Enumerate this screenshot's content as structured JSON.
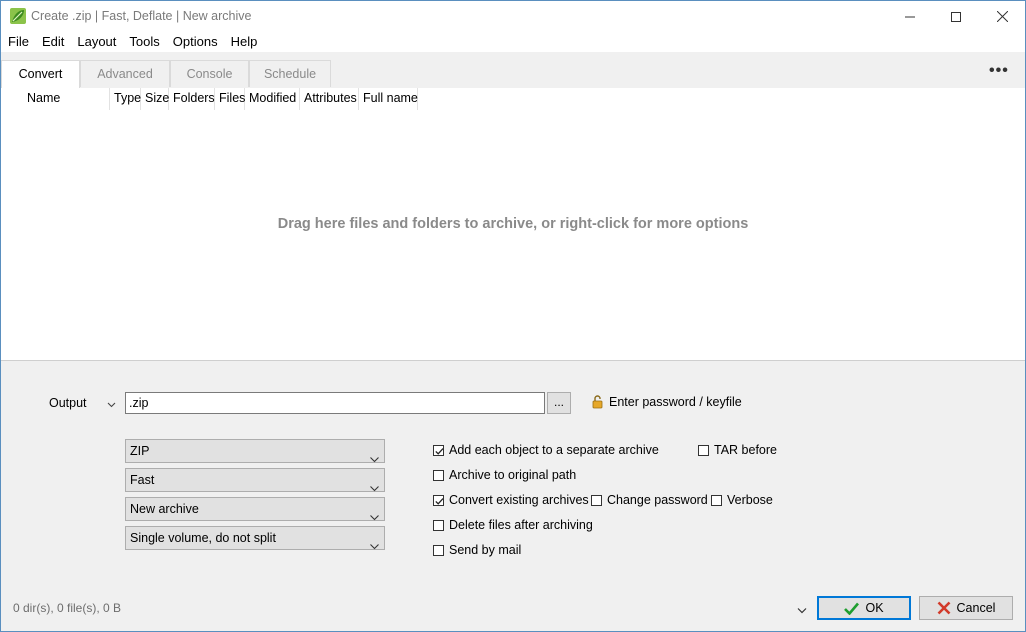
{
  "window": {
    "title": "Create .zip | Fast, Deflate | New archive"
  },
  "menu": [
    "File",
    "Edit",
    "Layout",
    "Tools",
    "Options",
    "Help"
  ],
  "tabs": [
    {
      "label": "Convert",
      "active": true
    },
    {
      "label": "Advanced",
      "active": false
    },
    {
      "label": "Console",
      "active": false
    },
    {
      "label": "Schedule",
      "active": false
    }
  ],
  "more_label": "•••",
  "columns": [
    "Name",
    "Type",
    "Size",
    "Folders",
    "Files",
    "Modified",
    "Attributes",
    "Full name"
  ],
  "drop_hint": "Drag here files and folders to archive, or right-click for more options",
  "output": {
    "label": "Output",
    "value": ".zip",
    "browse_label": "...",
    "password_link": "Enter password / keyfile"
  },
  "selects": {
    "format": "ZIP",
    "compression": "Fast",
    "mode": "New archive",
    "split": "Single volume, do not split"
  },
  "options": {
    "separate_archive": {
      "label": "Add each object to a separate archive",
      "checked": true
    },
    "tar_before": {
      "label": "TAR before",
      "checked": false
    },
    "original_path": {
      "label": "Archive to original path",
      "checked": false
    },
    "convert_existing": {
      "label": "Convert existing archives",
      "checked": true
    },
    "change_password": {
      "label": "Change password",
      "checked": false
    },
    "verbose": {
      "label": "Verbose",
      "checked": false
    },
    "delete_after": {
      "label": "Delete files after archiving",
      "checked": false
    },
    "send_mail": {
      "label": "Send by mail",
      "checked": false
    }
  },
  "status": "0 dir(s), 0 file(s), 0 B",
  "buttons": {
    "ok": "OK",
    "cancel": "Cancel"
  },
  "icons": {
    "app": "peazip-leaf-icon",
    "password": "padlock-open-icon",
    "ok": "checkmark-icon",
    "cancel": "x-icon"
  },
  "colors": {
    "accent": "#0078d7",
    "ok_check": "#1e9e2f",
    "cancel_x": "#d23a2a",
    "lock": "#d89b1a"
  }
}
